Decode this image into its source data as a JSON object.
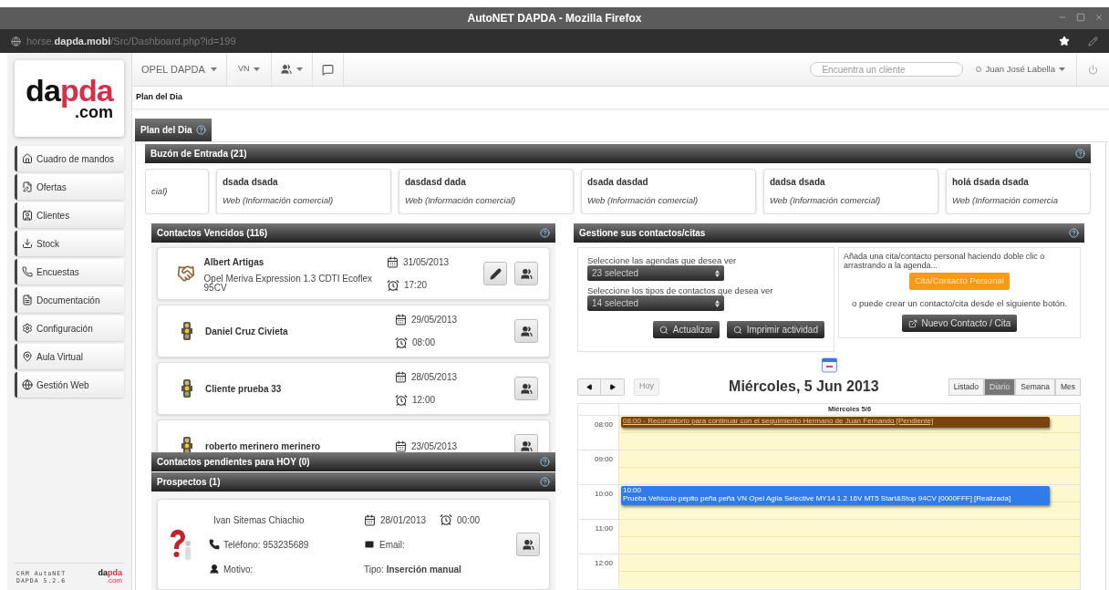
{
  "window": {
    "title": "AutoNET DAPDA - Mozilla Firefox"
  },
  "address_bar": {
    "url": "horse.**dapda.mobi**/Src/Dashboard.php?id=199"
  },
  "logo": {
    "left": "da",
    "right": "pda",
    "suffix": ".com"
  },
  "sidebar": {
    "items": [
      {
        "label": "Cuadro de mandos"
      },
      {
        "label": "Ofertas"
      },
      {
        "label": "Clientes"
      },
      {
        "label": "Stock"
      },
      {
        "label": "Encuestas"
      },
      {
        "label": "Documentación"
      },
      {
        "label": "Configuración"
      },
      {
        "label": "Aula Virtual"
      },
      {
        "label": "Gestión Web"
      }
    ],
    "footer": {
      "line_1": "CRM AutoNET",
      "line_2": "DAPDA 5.2.6",
      "logo_left": "da",
      "logo_right": "pda",
      "logo_suffix": ".com"
    }
  },
  "top_nav": {
    "company": "OPEL DAPDA",
    "section": "VN",
    "search": {
      "placeholder": "Encuentra un cliente"
    },
    "user": "Juan José Labella"
  },
  "breadcrumb": "Plan del Dia",
  "tabs": [
    {
      "label": "Plan del Dia",
      "selected": true
    }
  ],
  "inbox": {
    "title": "Buzón de Entrada (21)",
    "cards": [
      {
        "subtitle": "cial)"
      },
      {
        "name": "dsada dsada",
        "subtitle": "Web (Información comercial)"
      },
      {
        "name": "dasdasd dada",
        "subtitle": "Web (Información comercial)"
      },
      {
        "name": "dsada dasdad",
        "subtitle": "Web (Información comercial)"
      },
      {
        "name": "dadsa dsada",
        "subtitle": "Web (Información comercial)"
      },
      {
        "name": "holá dsada dsada",
        "subtitle": "Web (Información comercia"
      }
    ]
  },
  "overdue": {
    "title": "Contactos Vencidos (116)",
    "contacts": [
      {
        "kind": "offer",
        "name": "Albert Artigas",
        "vehicle": "Opel Meriva Expression 1.3 CDTI Ecoflex 95CV",
        "date": "31/05/2013",
        "time": "17:20"
      },
      {
        "kind": "contact",
        "name": "Daniel Cruz Civieta",
        "date": "29/05/2013",
        "time": "08:00"
      },
      {
        "kind": "contact",
        "name": "Cliente prueba 33",
        "date": "28/05/2013",
        "time": "12:00"
      },
      {
        "kind": "contact",
        "name": "roberto merinero merinero",
        "date": "23/05/2013"
      }
    ]
  },
  "today": {
    "title": "Contactos pendientes para HOY (0)"
  },
  "prospects": {
    "title": "Prospectos (1)",
    "items": [
      {
        "name": "Ivan Sitemas Chiachio",
        "date": "28/01/2013",
        "time": "00:00",
        "phone": "Teléfono: 953235689",
        "email": "Email:",
        "reason": "Motivo:",
        "type": "Tipo: **Inserción manual**"
      }
    ]
  },
  "manage": {
    "title": "Gestione sus contactos/citas",
    "agenda_label": "Seleccione las agendas que desea ver",
    "agenda_value": "23 selected",
    "types_label": "Seleccione los tipos de contactos que desea ver",
    "types_value": "14 selected",
    "buttons": [
      "Actualizar",
      "Imprimir actividad"
    ],
    "hint": "Añada una cita/contacto personal haciendo doble clic o arrastrando a la agenda...",
    "personal_button": "Cita/Contacto Personal",
    "or_text": "o puede crear un contacto/cita desde el siguiente botón.",
    "new_button": "Nuevo Contacto / Cita"
  },
  "calendar": {
    "today_button": {
      "label": "Hoy",
      "disabled": true
    },
    "title": "Miércoles, 5 Jun 2013",
    "views": [
      {
        "label": "Listado",
        "selected": false
      },
      {
        "label": "Diario",
        "selected": true
      },
      {
        "label": "Semana",
        "selected": false
      },
      {
        "label": "Mes",
        "selected": false
      }
    ],
    "day_header": "Miércoles 5/6",
    "hours": [
      {
        "label": "08:00",
        "events": [
          {
            "text": "08:00 - Recordatorio para continuar con el seguimiento Hermano de Juan Fernando [Pendiente]",
            "color": "#7b440c"
          }
        ]
      },
      {
        "label": "09:00"
      },
      {
        "label": "10:00",
        "events": [
          {
            "heading": "10:00",
            "text": "Prueba Vehículo pepito peña peña VN Opel Agila Selective MY14 1.2 16V MT5 Start&Stop 94CV [0000FFF] [Realizada]",
            "color": "#2f7ce8"
          }
        ]
      },
      {
        "label": "11:00"
      },
      {
        "label": "12:00"
      }
    ]
  }
}
